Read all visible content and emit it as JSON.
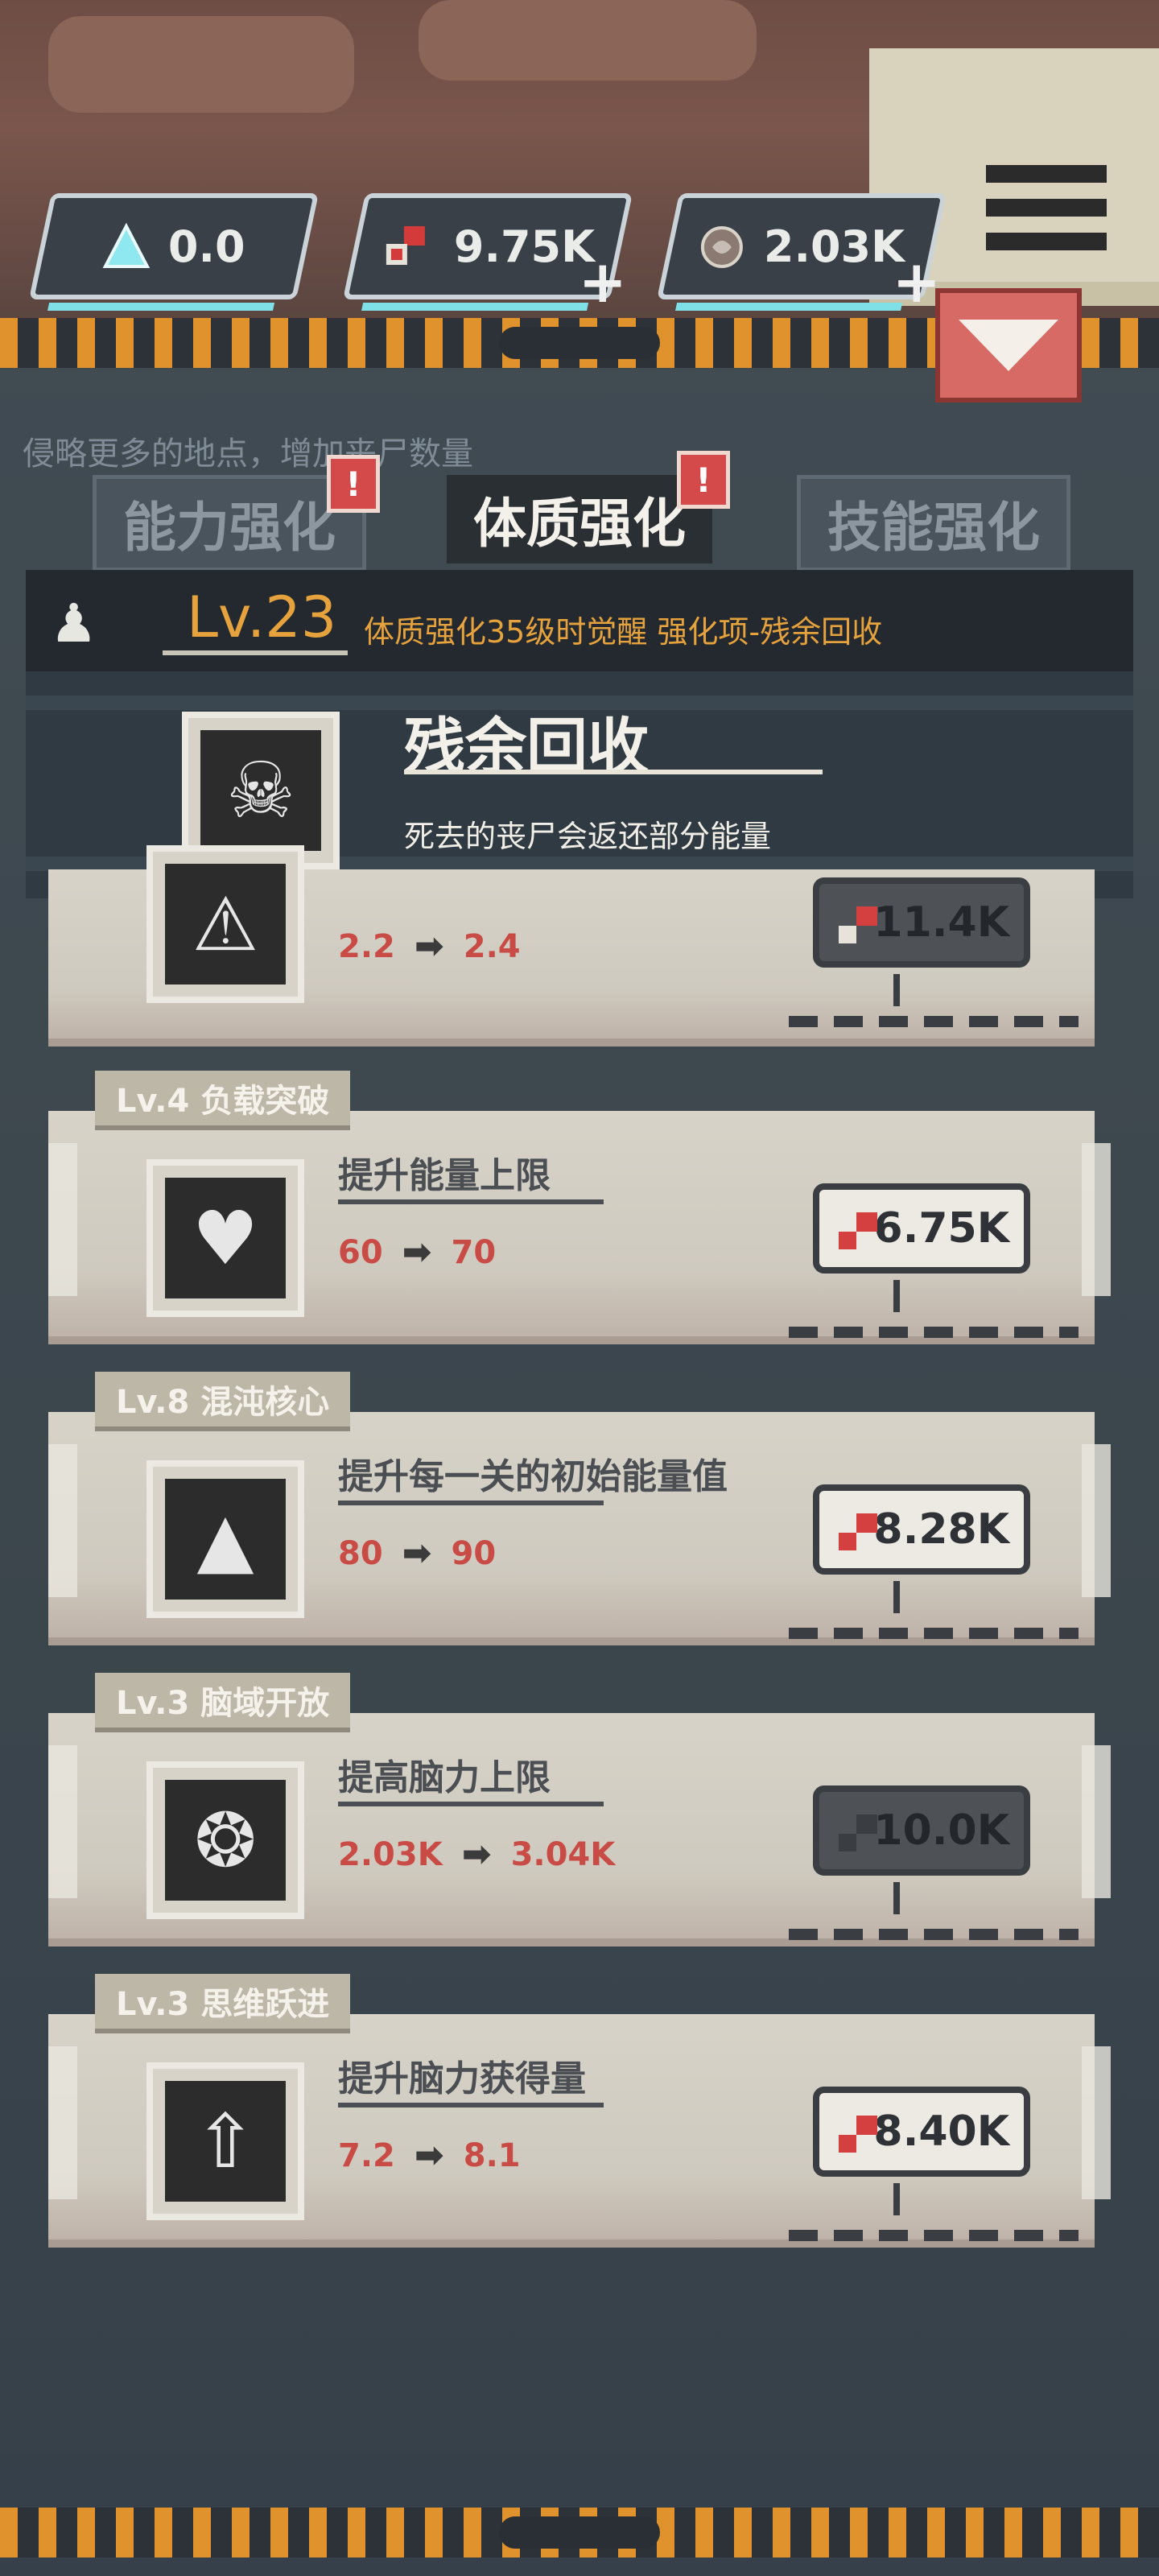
{
  "resources": [
    {
      "name": "energy-crystal",
      "value": "0.0",
      "has_plus": false
    },
    {
      "name": "flesh-currency",
      "value": "9.75K",
      "has_plus": true
    },
    {
      "name": "brain-currency",
      "value": "2.03K",
      "has_plus": true
    }
  ],
  "background_hint": "侵略更多的地点，增加丧尸数量",
  "tabs": [
    {
      "label": "能力强化",
      "active": false,
      "badge": "!"
    },
    {
      "label": "体质强化",
      "active": true,
      "badge": "!"
    },
    {
      "label": "技能强化",
      "active": false,
      "badge": ""
    }
  ],
  "level_panel": {
    "level": "Lv.23",
    "description": "体质强化35级时觉醒 强化项-残余回收"
  },
  "awakening": {
    "title": "残余回收",
    "description": "死去的丧尸会返还部分能量"
  },
  "upgrades": [
    {
      "tag": "",
      "description": "",
      "from": "2.2",
      "to": "2.4",
      "price": "11.4K",
      "affordable": false,
      "icon": "warning-figure-icon"
    },
    {
      "tag": "Lv.4 负载突破",
      "description": "提升能量上限",
      "from": "60",
      "to": "70",
      "price": "6.75K",
      "affordable": true,
      "icon": "torso-icon"
    },
    {
      "tag": "Lv.8 混沌核心",
      "description": "提升每一关的初始能量值",
      "from": "80",
      "to": "90",
      "price": "8.28K",
      "affordable": true,
      "icon": "chaos-triangle-icon"
    },
    {
      "tag": "Lv.3 脑域开放",
      "description": "提高脑力上限",
      "from": "2.03K",
      "to": "3.04K",
      "price": "10.0K",
      "affordable": false,
      "icon": "brain-halo-icon"
    },
    {
      "tag": "Lv.3 思维跃进",
      "description": "提升脑力获得量",
      "from": "7.2",
      "to": "8.1",
      "price": "8.40K",
      "affordable": true,
      "icon": "brain-up-icon"
    }
  ],
  "colors": {
    "accent_orange": "#e6a23c",
    "value_red": "#c94b45",
    "collapse_red": "#d86a66"
  }
}
